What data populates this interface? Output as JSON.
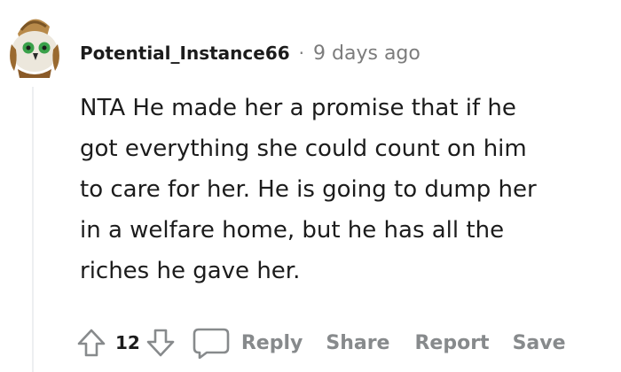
{
  "comment": {
    "author": "Potential_Instance66",
    "separator": "·",
    "timestamp": "9 days ago",
    "body_lines": [
      "NTA He made her a promise that if he",
      "got everything she could count on him",
      "to care for her. He is going to dump her",
      "in a welfare home, but he has all the",
      "riches he gave her."
    ],
    "score": "12"
  },
  "actions": {
    "reply": "Reply",
    "share": "Share",
    "report": "Report",
    "save": "Save"
  },
  "icons": {
    "upvote": "arrow-up-icon",
    "downvote": "arrow-down-icon",
    "reply": "speech-bubble-icon",
    "avatar": "snoo-avatar"
  },
  "colors": {
    "text": "#1c1c1c",
    "muted": "#7c7c7c",
    "action": "#878a8c",
    "thread_line": "#edeff1"
  }
}
